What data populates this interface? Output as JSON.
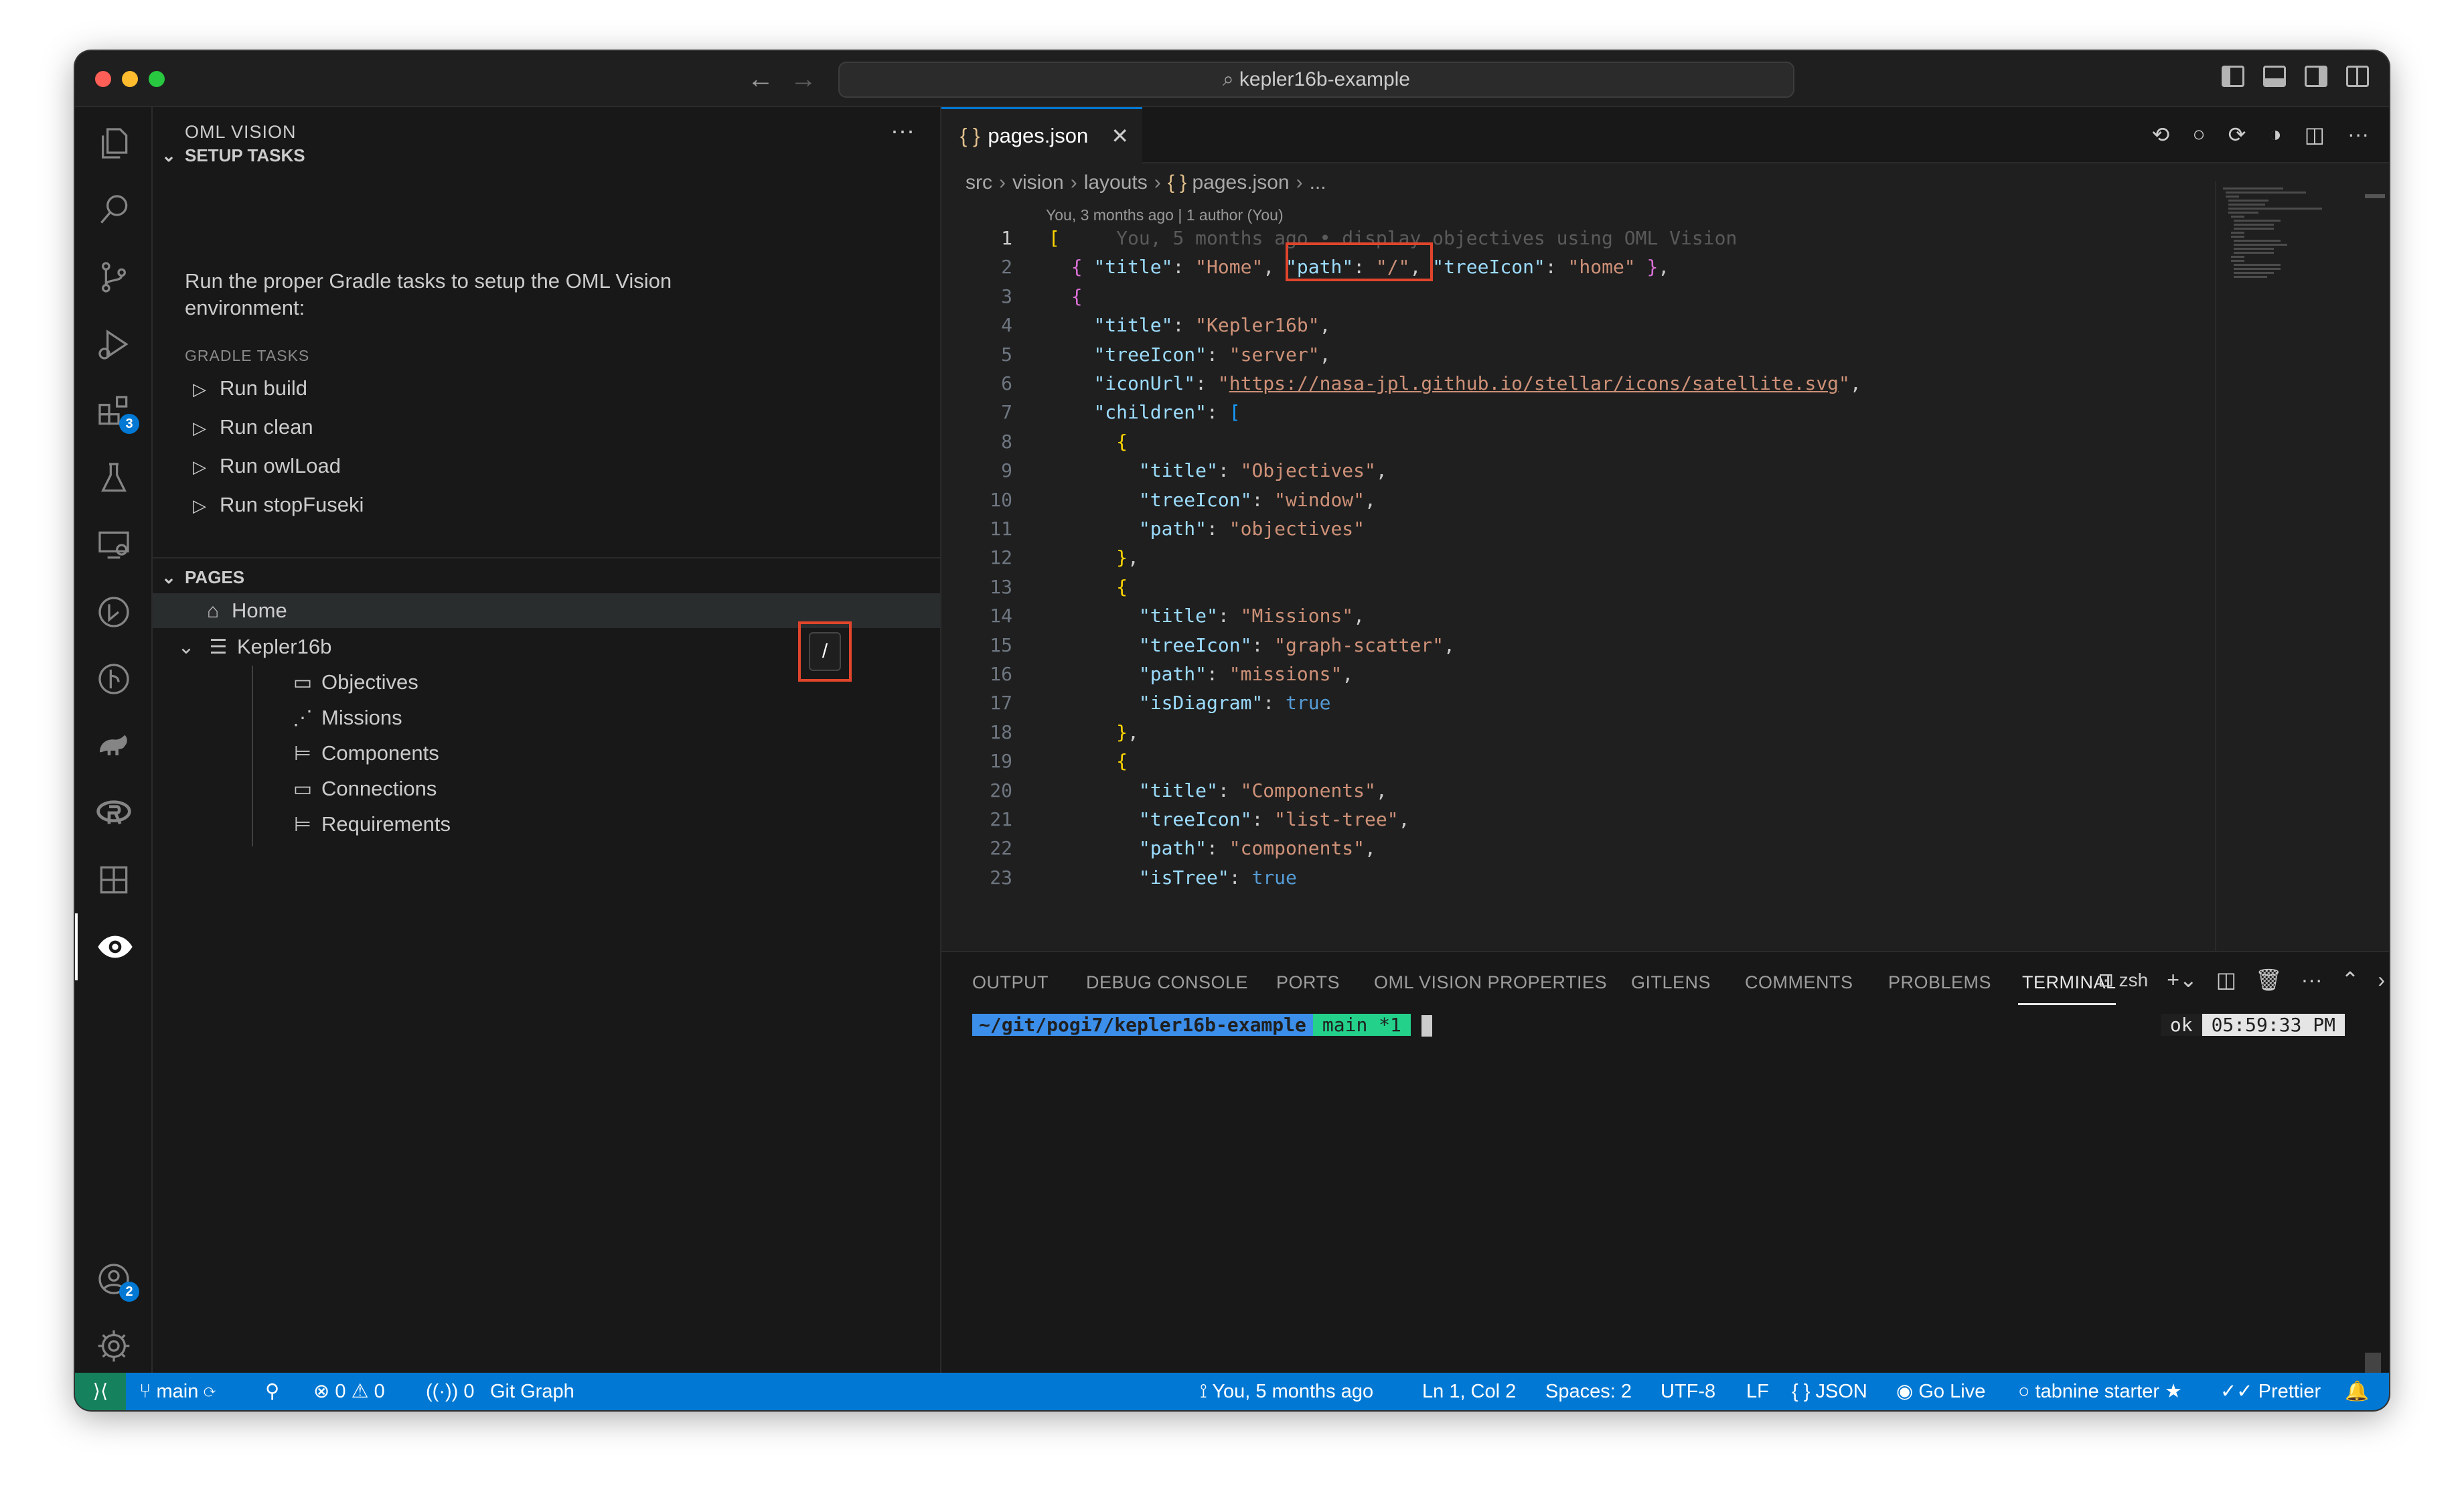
{
  "window": {
    "search_text": "kepler16b-example"
  },
  "activity_bar": {
    "extensions_badge": "3",
    "accounts_badge": "2"
  },
  "sidebar": {
    "title": "OML VISION",
    "more": "···",
    "setup_tasks": {
      "header": "SETUP TASKS",
      "description": "Run the proper Gradle tasks to setup the OML Vision environment:",
      "subheader": "GRADLE TASKS",
      "tasks": [
        "Run build",
        "Run clean",
        "Run owlLoad",
        "Run stopFuseki"
      ]
    },
    "pages": {
      "header": "PAGES",
      "items": [
        {
          "label": "Home",
          "icon": "home-icon"
        },
        {
          "label": "Kepler16b",
          "icon": "server-icon"
        },
        {
          "label": "Objectives",
          "icon": "window-icon"
        },
        {
          "label": "Missions",
          "icon": "graph-scatter-icon"
        },
        {
          "label": "Components",
          "icon": "list-tree-icon"
        },
        {
          "label": "Connections",
          "icon": "window-icon"
        },
        {
          "label": "Requirements",
          "icon": "list-tree-icon"
        }
      ]
    },
    "path_popup": "/"
  },
  "editor": {
    "tab_label": "pages.json",
    "tab_braces": "{ }",
    "breadcrumb": [
      "src",
      "vision",
      "layouts",
      "pages.json",
      "..."
    ],
    "blame_header": "You, 3 months ago | 1 author (You)",
    "ghost_blame": "You, 5 months ago • display objectives using OML Vision",
    "line_numbers": [
      "1",
      "2",
      "3",
      "4",
      "5",
      "6",
      "7",
      "8",
      "9",
      "10",
      "11",
      "12",
      "13",
      "14",
      "15",
      "16",
      "17",
      "18",
      "19",
      "20",
      "21",
      "22",
      "23"
    ]
  },
  "panel": {
    "tabs": [
      "OUTPUT",
      "DEBUG CONSOLE",
      "PORTS",
      "OML VISION PROPERTIES",
      "GITLENS",
      "COMMENTS",
      "PROBLEMS",
      "TERMINAL"
    ],
    "active_tab": "TERMINAL",
    "shell": "zsh",
    "prompt_path": "~/git/pogi7/kepler16b-example",
    "prompt_branch": "main *1",
    "status_ok": "ok",
    "time": "05:59:33 PM"
  },
  "statusbar": {
    "branch": "main",
    "errors": "0",
    "warnings": "0",
    "ports": "0",
    "git_graph": "Git Graph",
    "blame": "You, 5 months ago",
    "cursor": "Ln 1, Col 2",
    "spaces": "Spaces: 2",
    "encoding": "UTF-8",
    "eol": "LF",
    "language": "JSON",
    "go_live": "Go Live",
    "tabnine": "tabnine starter",
    "prettier": "Prettier"
  }
}
